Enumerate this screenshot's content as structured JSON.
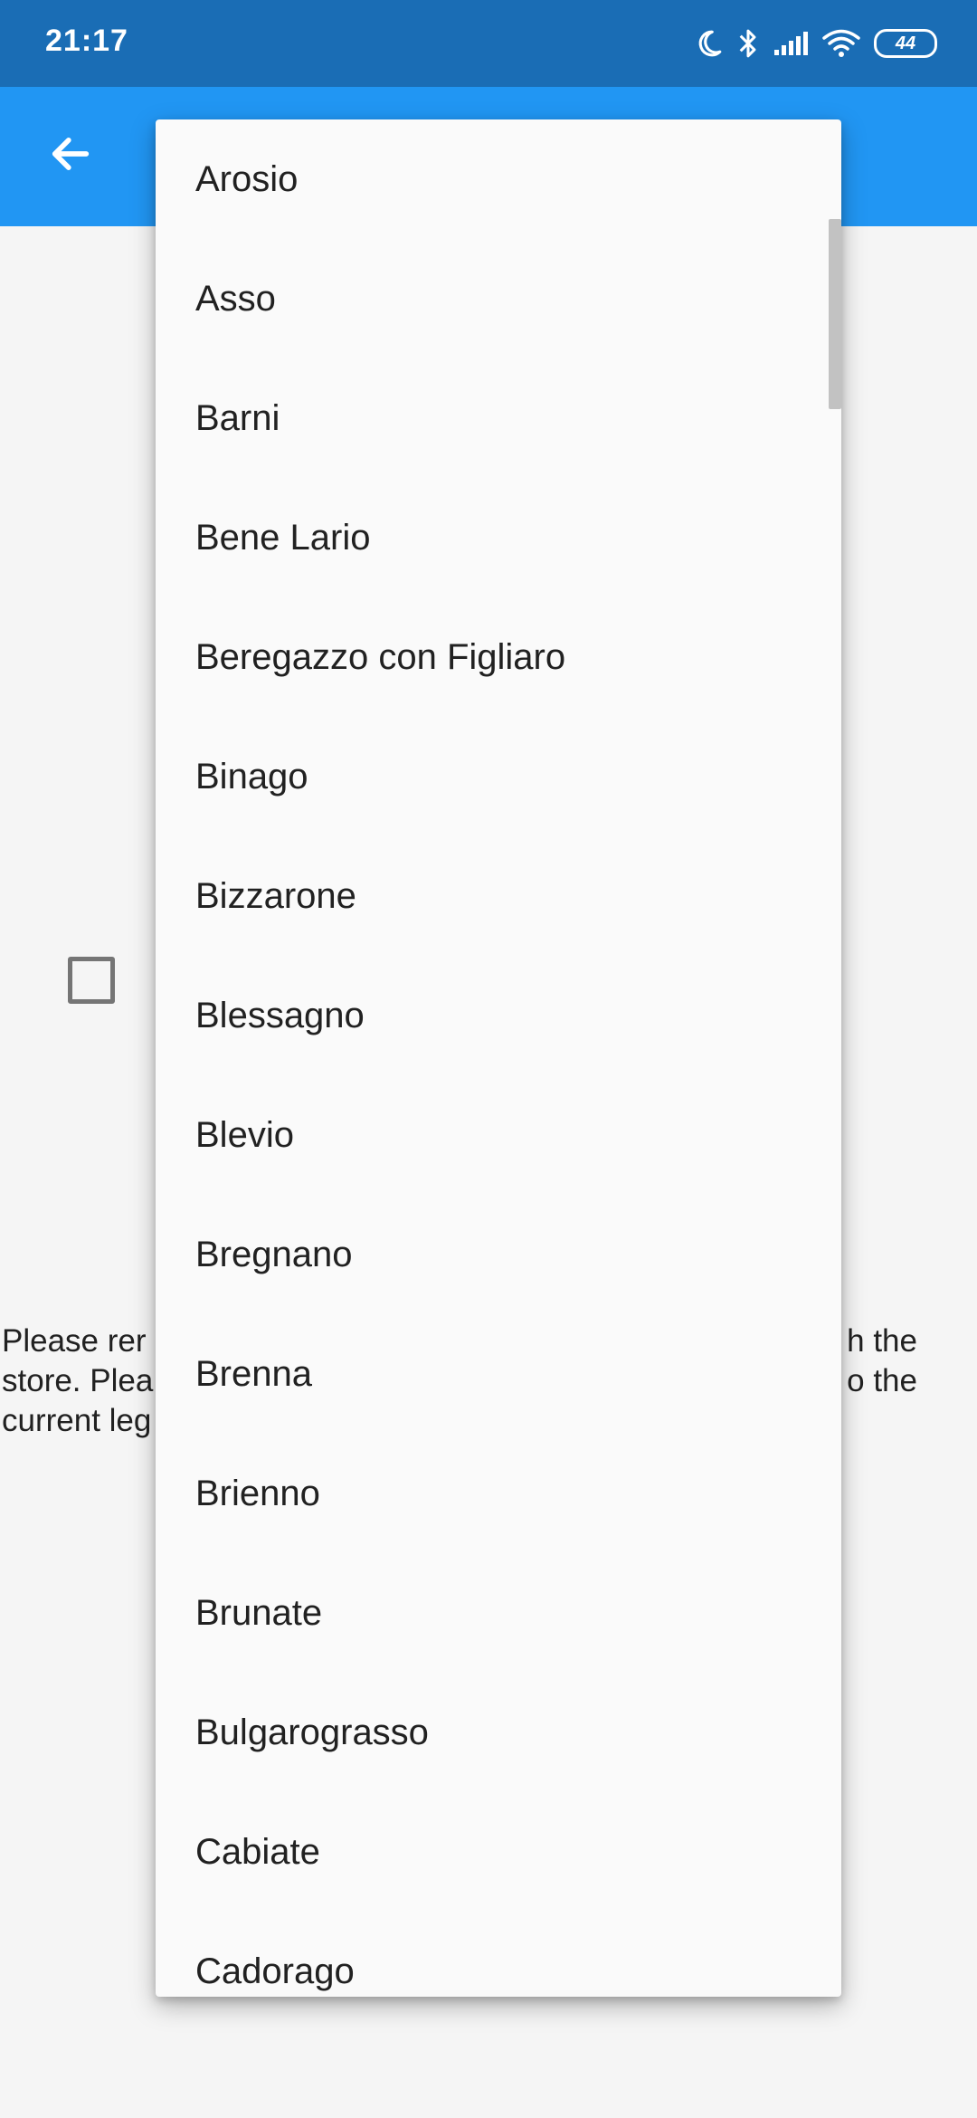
{
  "status_bar": {
    "time": "21:17",
    "battery": "44",
    "icons": [
      "moon-icon",
      "bluetooth-icon",
      "signal-icon",
      "wifi-icon",
      "battery-icon"
    ]
  },
  "app_bar": {
    "color": "#2196f3",
    "back_icon": "arrow-back-icon"
  },
  "notice": {
    "line1_left": "Please rer",
    "line1_right": "h the",
    "line2_left": "store. Plea",
    "line2_right": "o the",
    "line3_left": "current leg"
  },
  "dropdown": {
    "items": [
      "Arosio",
      "Asso",
      "Barni",
      "Bene Lario",
      "Beregazzo con Figliaro",
      "Binago",
      "Bizzarone",
      "Blessagno",
      "Blevio",
      "Bregnano",
      "Brenna",
      "Brienno",
      "Brunate",
      "Bulgarograsso",
      "Cabiate",
      "Cadorago"
    ]
  },
  "colors": {
    "status_bar": "#1a6db5",
    "app_bar": "#2196f3",
    "background": "#f5f5f5",
    "menu_background": "#fafafa"
  }
}
